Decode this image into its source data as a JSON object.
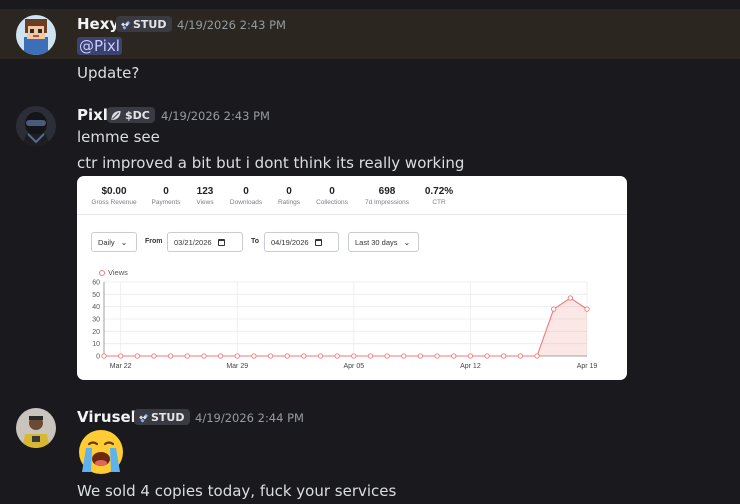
{
  "messages": [
    {
      "username": "Hexy",
      "tag": "STUD",
      "tag_icon": "diamond-grid-icon",
      "timestamp": "4/19/2026 2:43 PM",
      "mention": "@Pixl",
      "lines": [
        "Update?"
      ]
    },
    {
      "username": "Pixl",
      "tag": "$DC",
      "tag_icon": "leaf-icon",
      "timestamp": "4/19/2026 2:43 PM",
      "lines": [
        "lemme see",
        "ctr improved a bit but i dont think its really working"
      ]
    },
    {
      "username": "Virusek",
      "tag": "STUD",
      "tag_icon": "diamond-grid-icon",
      "timestamp": "4/19/2026 2:44 PM",
      "emoji": "loudly-crying-face",
      "lines": [
        "We sold 4 copies today, fuck your services"
      ]
    }
  ],
  "dashboard": {
    "stats": [
      {
        "value": "$0.00",
        "label": "Gross Revenue"
      },
      {
        "value": "0",
        "label": "Payments"
      },
      {
        "value": "123",
        "label": "Views"
      },
      {
        "value": "0",
        "label": "Downloads"
      },
      {
        "value": "0",
        "label": "Ratings"
      },
      {
        "value": "0",
        "label": "Collections"
      },
      {
        "value": "698",
        "label": "7d Impressions"
      },
      {
        "value": "0.72%",
        "label": "CTR"
      }
    ],
    "interval": "Daily",
    "from_label": "From",
    "from_date": "03/21/2026",
    "to_label": "To",
    "to_date": "04/19/2026",
    "range": "Last 30 days"
  },
  "colors": {
    "background": "#1a1a1e",
    "highlight": "#2c2620",
    "series": "#f07a7a"
  },
  "chart_data": {
    "type": "area",
    "series": [
      {
        "name": "Views",
        "values": [
          0,
          0,
          0,
          0,
          0,
          0,
          0,
          0,
          0,
          0,
          0,
          0,
          0,
          0,
          0,
          0,
          0,
          0,
          0,
          0,
          0,
          0,
          0,
          0,
          0,
          0,
          0,
          38,
          47,
          38
        ]
      }
    ],
    "x_tick_labels": [
      "Mar 22",
      "Mar 29",
      "Apr 05",
      "Apr 12",
      "Apr 19"
    ],
    "x_tick_index": [
      1,
      8,
      15,
      22,
      29
    ],
    "y_ticks": [
      0,
      10,
      20,
      30,
      40,
      50,
      60
    ],
    "ylim": [
      0,
      60
    ],
    "grid": true,
    "legend": "top-left"
  }
}
